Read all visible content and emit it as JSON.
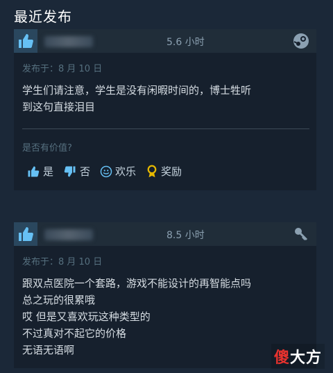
{
  "section": {
    "title": "最近发布"
  },
  "reviews": [
    {
      "hours": "5.6 小时",
      "posted": "发布于：8 月 10 日",
      "lines": [
        "学生们请注意，学生是没有闲暇时间的，博士牲听",
        "到这句直接泪目"
      ],
      "platform_icon": "steam-icon",
      "helpful_question": "是否有价值?",
      "votes": {
        "yes": "是",
        "no": "否",
        "funny": "欢乐",
        "award": "奖励"
      }
    },
    {
      "hours": "8.5 小时",
      "posted": "发布于：8 月 10 日",
      "lines": [
        "跟双点医院一个套路，游戏不能设计的再智能点吗",
        "总之玩的很累哦",
        "哎 但是又喜欢玩这种类型的",
        "不过真对不起它的价格",
        "无语无语啊"
      ],
      "platform_icon": "key-icon"
    }
  ],
  "watermark": {
    "part1": "傻",
    "part2": "大方"
  },
  "colors": {
    "background": "#1b2838",
    "card": "#16202d",
    "header": "#202d39",
    "thumb_up": "#66c0f4"
  }
}
